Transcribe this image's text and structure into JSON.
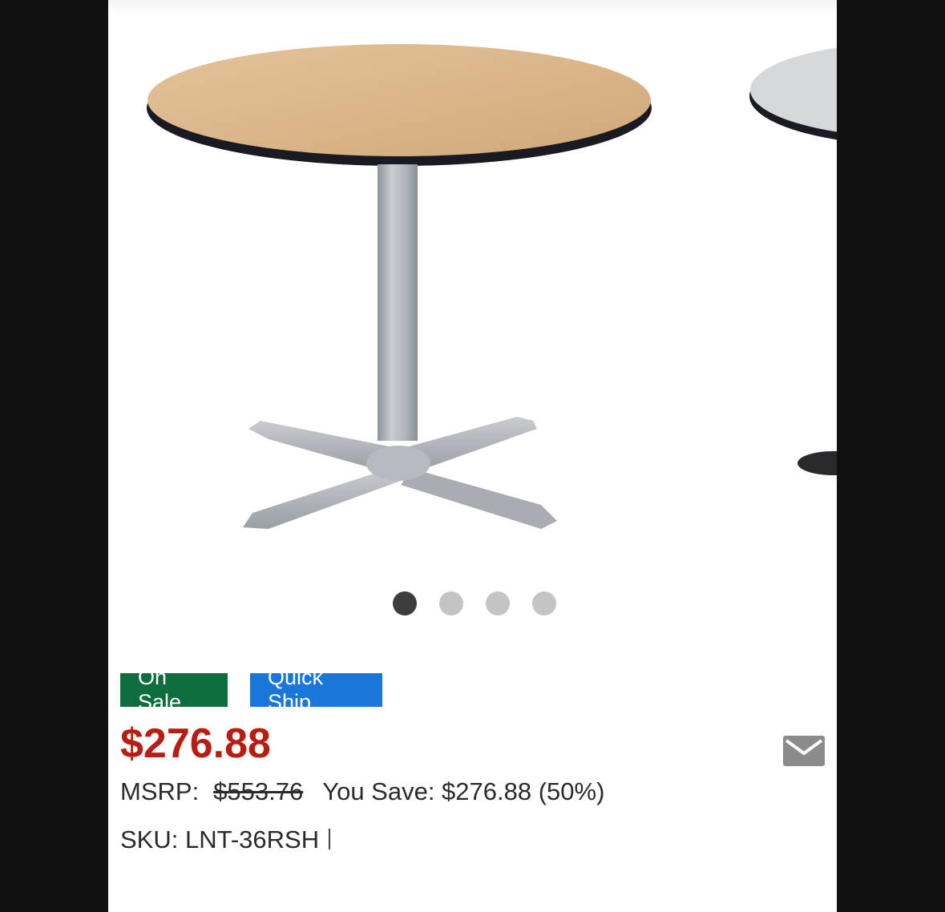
{
  "gallery": {
    "image_alt": "round table with gray x-base",
    "slide_count": 4,
    "active_slide": 1
  },
  "badges": {
    "on_sale": "On Sale",
    "quick_ship": "Quick Ship"
  },
  "price": {
    "current": "$276.88",
    "msrp_label": "MSRP:",
    "msrp_value": "$553.76",
    "savings": "You Save: $276.88 (50%)"
  },
  "sku": {
    "text": "SKU: LNT-36RSH"
  },
  "icons": {
    "share": "envelope-icon"
  },
  "colors": {
    "sale_badge": "#0e6d3c",
    "ship_badge": "#1a76d9",
    "price": "#b81c12",
    "dot_active": "#3d3d3d",
    "dot_inactive": "#c4c4c4"
  }
}
